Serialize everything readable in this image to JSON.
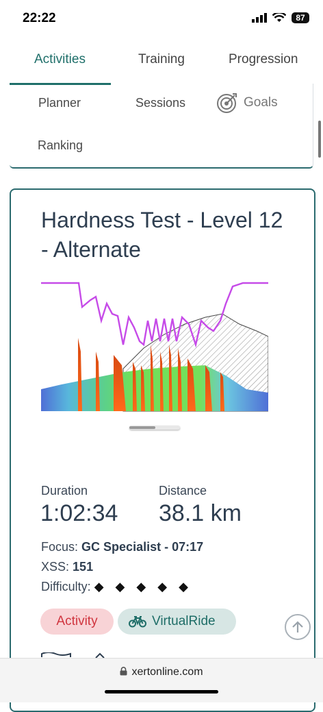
{
  "status": {
    "time": "22:22",
    "battery": "87"
  },
  "tabs": [
    {
      "label": "Activities",
      "active": true
    },
    {
      "label": "Training",
      "active": false
    },
    {
      "label": "Progression",
      "active": false
    }
  ],
  "subnav": {
    "planner": "Planner",
    "sessions": "Sessions",
    "goals": "Goals",
    "ranking": "Ranking"
  },
  "card": {
    "title": "Hardness Test - Level 12 - Alternate",
    "duration_label": "Duration",
    "duration_value": "1:02:34",
    "distance_label": "Distance",
    "distance_value": "38.1 km",
    "focus_label": "Focus:",
    "focus_value": "GC Specialist - 07:17",
    "xss_label": "XSS:",
    "xss_value": "151",
    "difficulty_label": "Difficulty:",
    "difficulty_value": "◆ ◆ ◆ ◆ ◆",
    "badge_activity": "Activity",
    "badge_ride": "VirtualRide"
  },
  "colors": {
    "accent": "#1f6f6a",
    "activity_badge_bg": "#f8d3d6",
    "ride_badge_bg": "#d7e6e4",
    "mpa_line": "#c64be8"
  },
  "browser": {
    "url": "xertonline.com"
  }
}
